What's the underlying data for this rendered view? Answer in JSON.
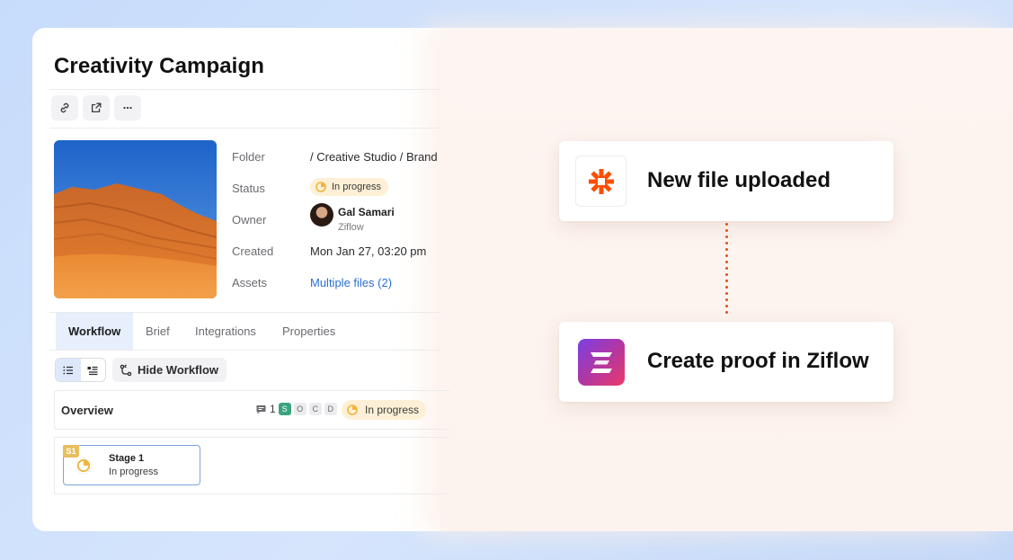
{
  "page": {
    "title": "Creativity Campaign"
  },
  "toolbar": {
    "icons": [
      "link-icon",
      "share-icon",
      "more-icon"
    ]
  },
  "details": {
    "folder_label": "Folder",
    "folder_value": "/ Creative Studio / Brand",
    "status_label": "Status",
    "status_value": "In progress",
    "owner_label": "Owner",
    "owner_name": "Gal Samari",
    "owner_org": "Ziflow",
    "created_label": "Created",
    "created_value": "Mon Jan 27, 03:20 pm",
    "assets_label": "Assets",
    "assets_value": "Multiple files (2)"
  },
  "tabs": [
    {
      "label": "Workflow",
      "active": true
    },
    {
      "label": "Brief",
      "active": false
    },
    {
      "label": "Integrations",
      "active": false
    },
    {
      "label": "Properties",
      "active": false
    }
  ],
  "workflow": {
    "hide_label": "Hide Workflow",
    "overview_title": "Overview",
    "comment_count": "1",
    "letters": [
      "S",
      "O",
      "C",
      "D"
    ],
    "overview_status": "In progress",
    "stage_badge": "S1",
    "stage_name": "Stage 1",
    "stage_status": "In progress"
  },
  "automation": {
    "trigger_label": "New file uploaded",
    "action_label": "Create proof in Ziflow"
  },
  "colors": {
    "accent": "#2b6fd1",
    "status_bg": "#fdf0d6",
    "status_icon": "#f0b43c",
    "zapier": "#ff4f00",
    "connector": "#d9531e"
  }
}
